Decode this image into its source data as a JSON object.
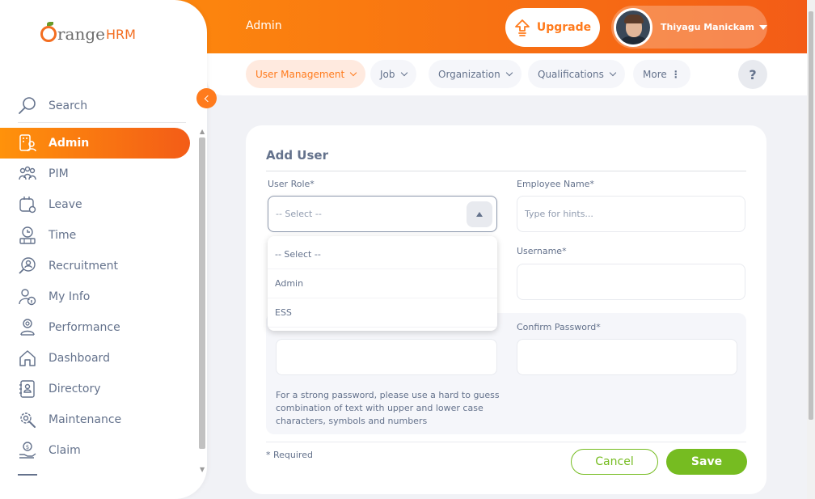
{
  "header": {
    "page_title": "Admin",
    "upgrade_label": "Upgrade",
    "user_name": "Thiyagu Manickam"
  },
  "brand": {
    "logo_main": "range",
    "logo_suffix": "HRM"
  },
  "tabs": [
    {
      "label": "User Management",
      "active": true
    },
    {
      "label": "Job"
    },
    {
      "label": "Organization"
    },
    {
      "label": "Qualifications"
    },
    {
      "label": "More"
    }
  ],
  "help_label": "?",
  "sidebar": {
    "search_label": "Search",
    "items": [
      {
        "label": "Admin",
        "icon": "admin-icon",
        "active": true
      },
      {
        "label": "PIM",
        "icon": "pim-icon"
      },
      {
        "label": "Leave",
        "icon": "leave-icon"
      },
      {
        "label": "Time",
        "icon": "time-icon"
      },
      {
        "label": "Recruitment",
        "icon": "recruitment-icon"
      },
      {
        "label": "My Info",
        "icon": "my-info-icon"
      },
      {
        "label": "Performance",
        "icon": "performance-icon"
      },
      {
        "label": "Dashboard",
        "icon": "dashboard-icon"
      },
      {
        "label": "Directory",
        "icon": "directory-icon"
      },
      {
        "label": "Maintenance",
        "icon": "maintenance-icon"
      },
      {
        "label": "Claim",
        "icon": "claim-icon"
      }
    ]
  },
  "form": {
    "title": "Add User",
    "user_role_label": "User Role*",
    "user_role_value": "-- Select --",
    "employee_name_label": "Employee Name*",
    "employee_name_placeholder": "Type for hints...",
    "username_label": "Username*",
    "confirm_password_label": "Confirm Password*",
    "password_hint": "For a strong password, please use a hard to guess combination of text with upper and lower case characters, symbols and numbers",
    "required_note": "* Required",
    "cancel_label": "Cancel",
    "save_label": "Save"
  },
  "dropdown_options": [
    "-- Select --",
    "Admin",
    "ESS"
  ],
  "colors": {
    "accent": "#ff7b1d",
    "accent_gradient_start": "#ff920b",
    "accent_gradient_end": "#f35c17",
    "save_green": "#76bc21",
    "text": "#64728c"
  }
}
